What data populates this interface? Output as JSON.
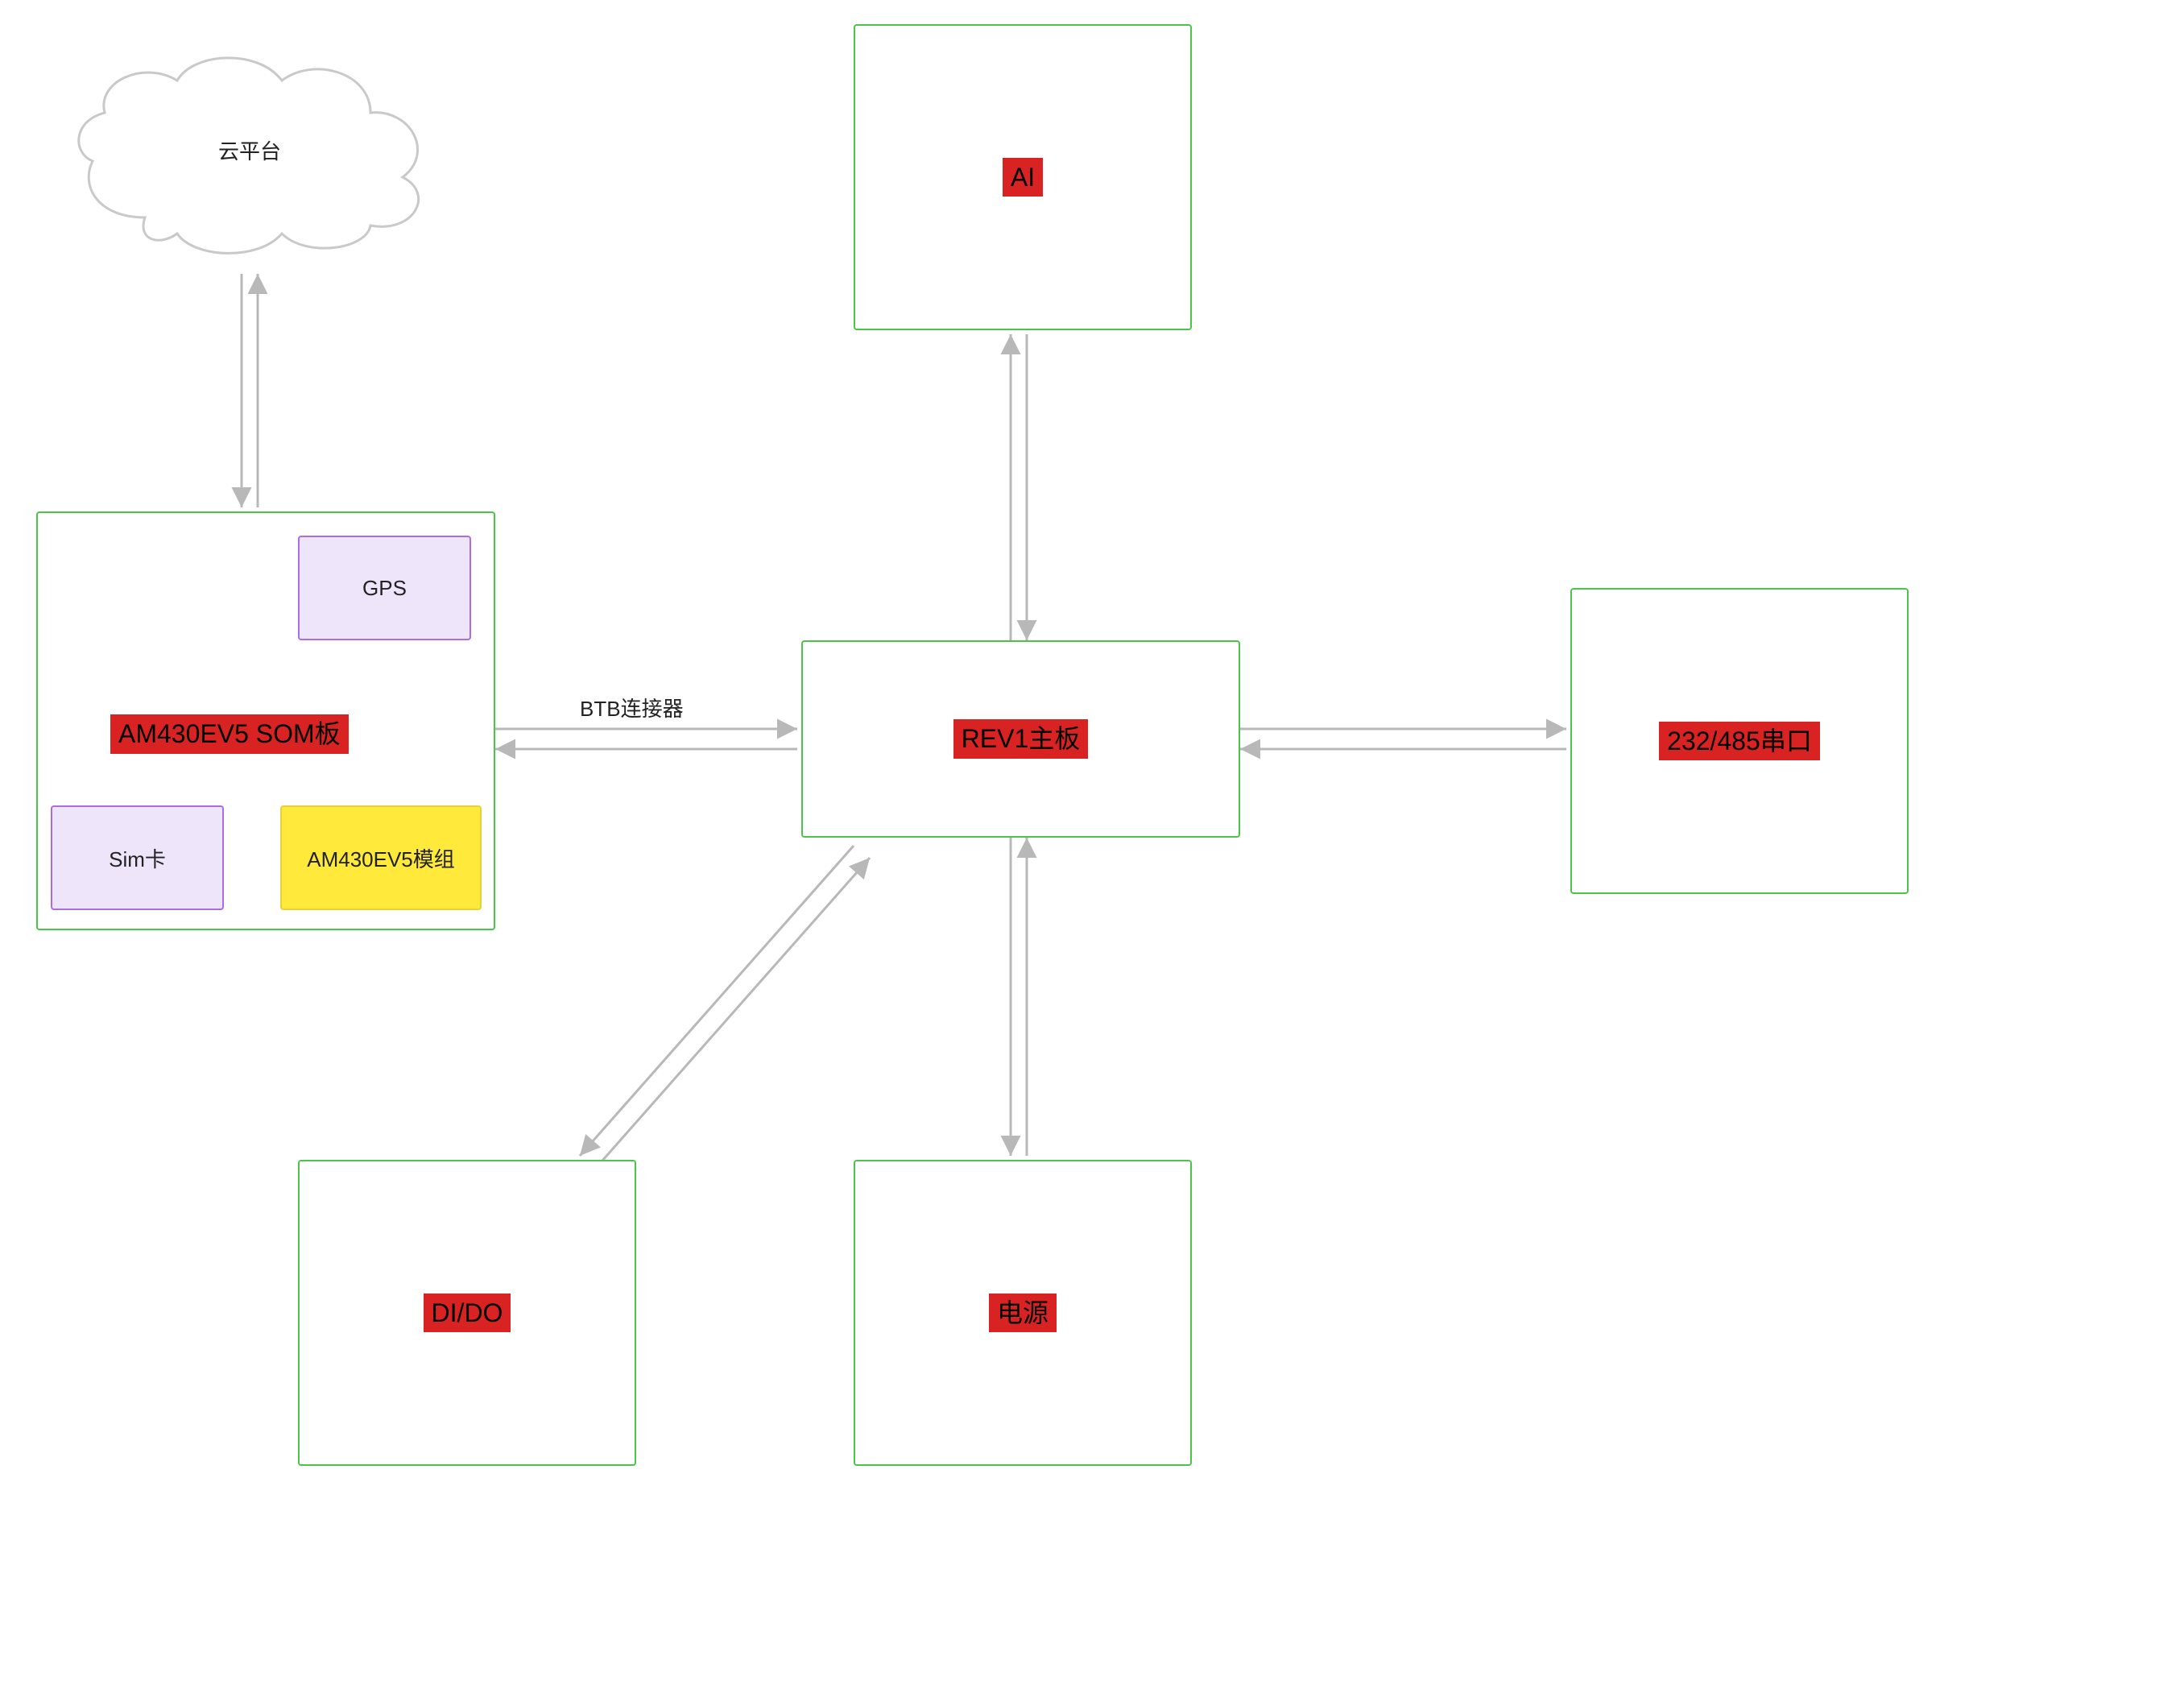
{
  "nodes": {
    "cloud": {
      "label": "云平台"
    },
    "som": {
      "label": "AM430EV5 SOM板"
    },
    "gps": {
      "label": "GPS"
    },
    "sim": {
      "label": "Sim卡"
    },
    "module": {
      "label": "AM430EV5模组"
    },
    "rev1": {
      "label": "REV1主板"
    },
    "ai": {
      "label": "AI"
    },
    "serial": {
      "label": "232/485串口"
    },
    "dido": {
      "label": "DI/DO"
    },
    "power": {
      "label": "电源"
    }
  },
  "edges": {
    "btb": {
      "label": "BTB连接器"
    }
  },
  "colors": {
    "green": "#4ac54a",
    "purple": "#a96ee6",
    "yellow": "#ffea3b",
    "red": "#d92323",
    "arrow": "#b8b8b8"
  }
}
